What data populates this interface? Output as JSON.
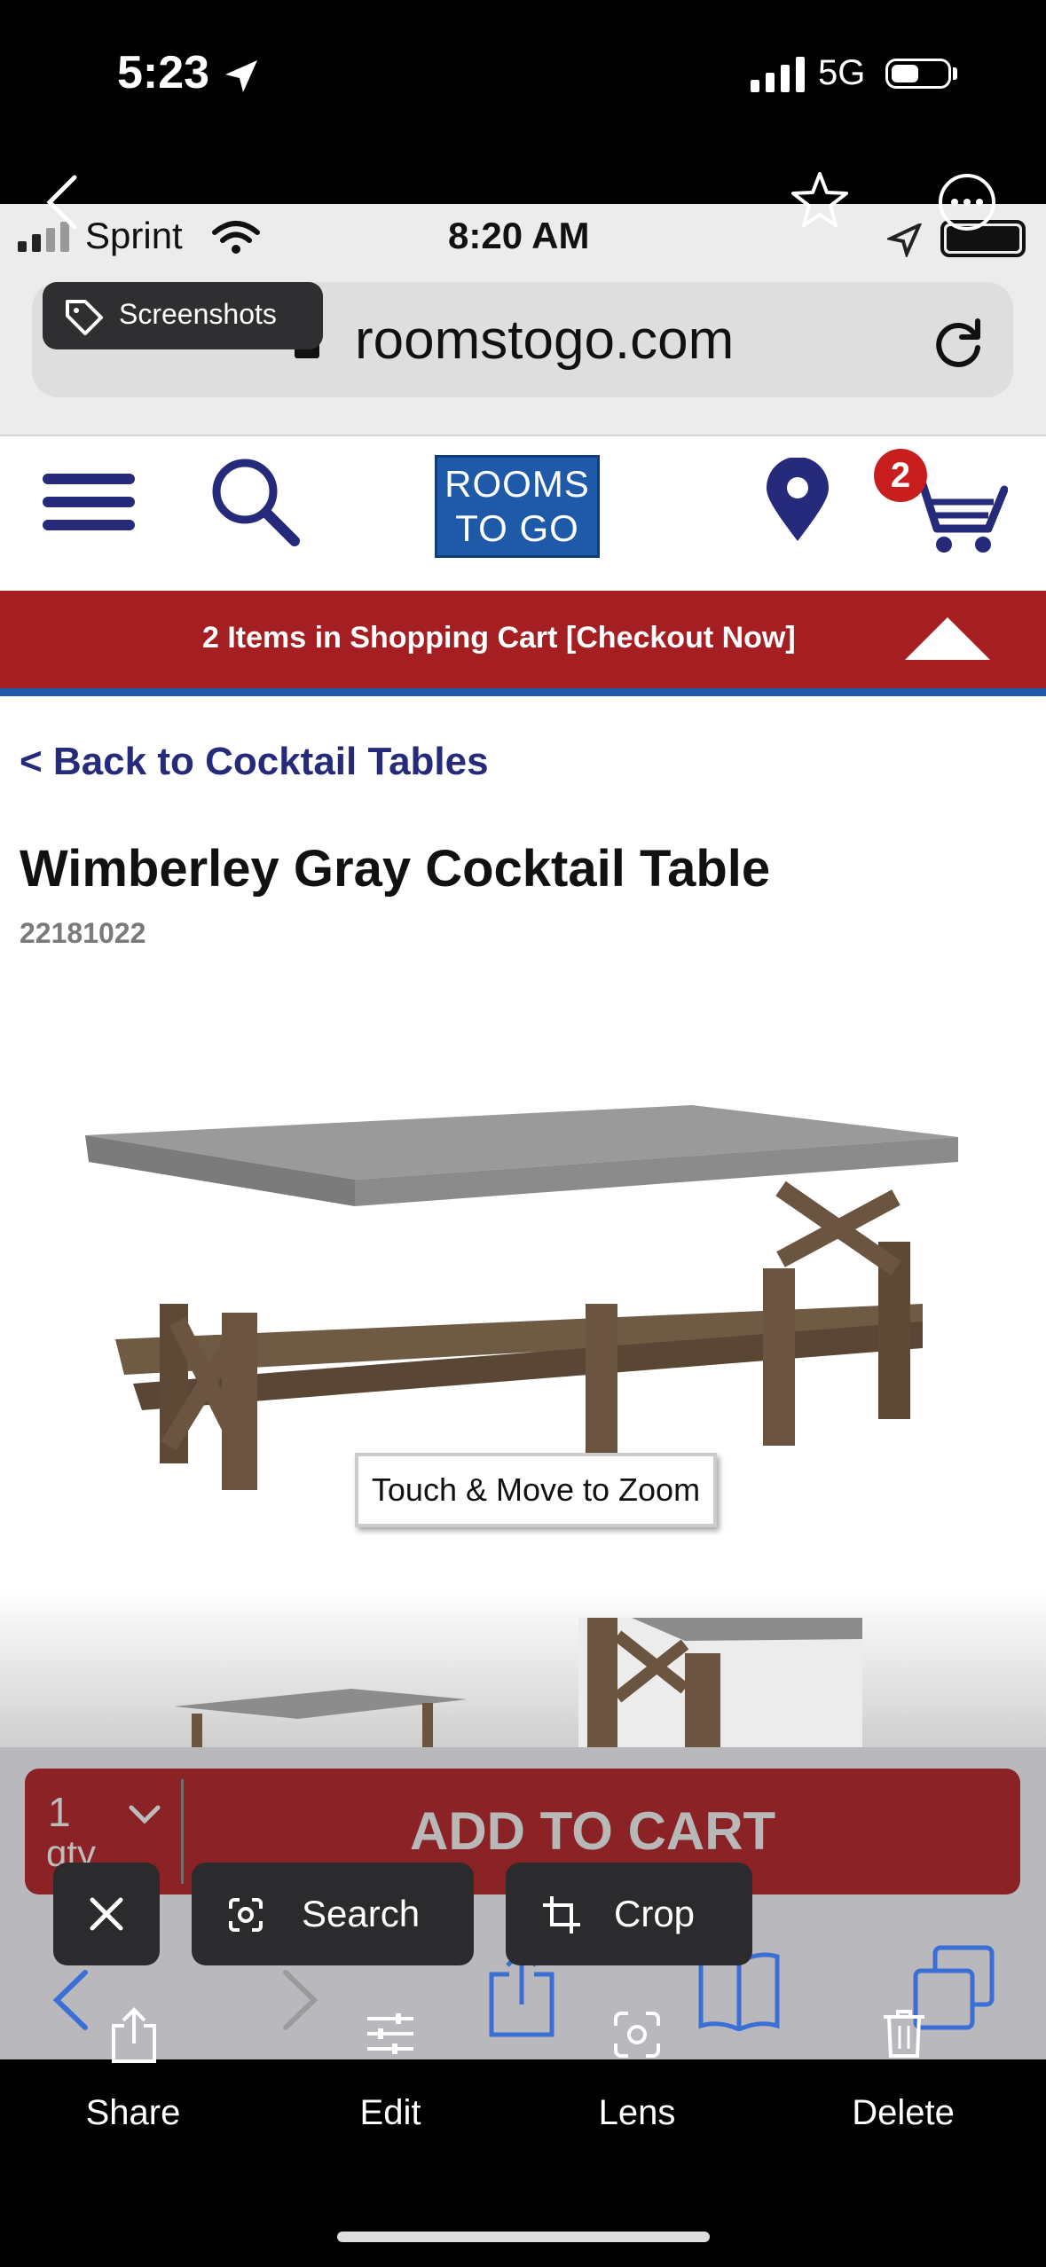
{
  "status_bar": {
    "time": "5:23",
    "network": "5G"
  },
  "inner_status_bar": {
    "carrier": "Sprint",
    "time": "8:20 AM"
  },
  "browser": {
    "tag_label": "Screenshots",
    "url": "roomstogo.com"
  },
  "site": {
    "logo_line1": "ROOMS",
    "logo_line2": "TO GO",
    "cart_count": "2",
    "cart_banner": "2 Items in Shopping Cart [Checkout Now]",
    "back_link": "< Back to Cocktail Tables"
  },
  "product": {
    "title": "Wimberley Gray Cocktail Table",
    "sku": "22181022",
    "zoom_hint": "Touch & Move to Zoom",
    "qty_value": "1",
    "qty_label": "qty",
    "add_to_cart": "ADD TO CART"
  },
  "lens_chips": {
    "search": "Search",
    "crop": "Crop"
  },
  "photos_toolbar": {
    "share": "Share",
    "edit": "Edit",
    "lens": "Lens",
    "delete": "Delete"
  },
  "colors": {
    "brand_red": "#a51e22",
    "brand_blue": "#1e5aa8",
    "link_navy": "#252a7a"
  }
}
